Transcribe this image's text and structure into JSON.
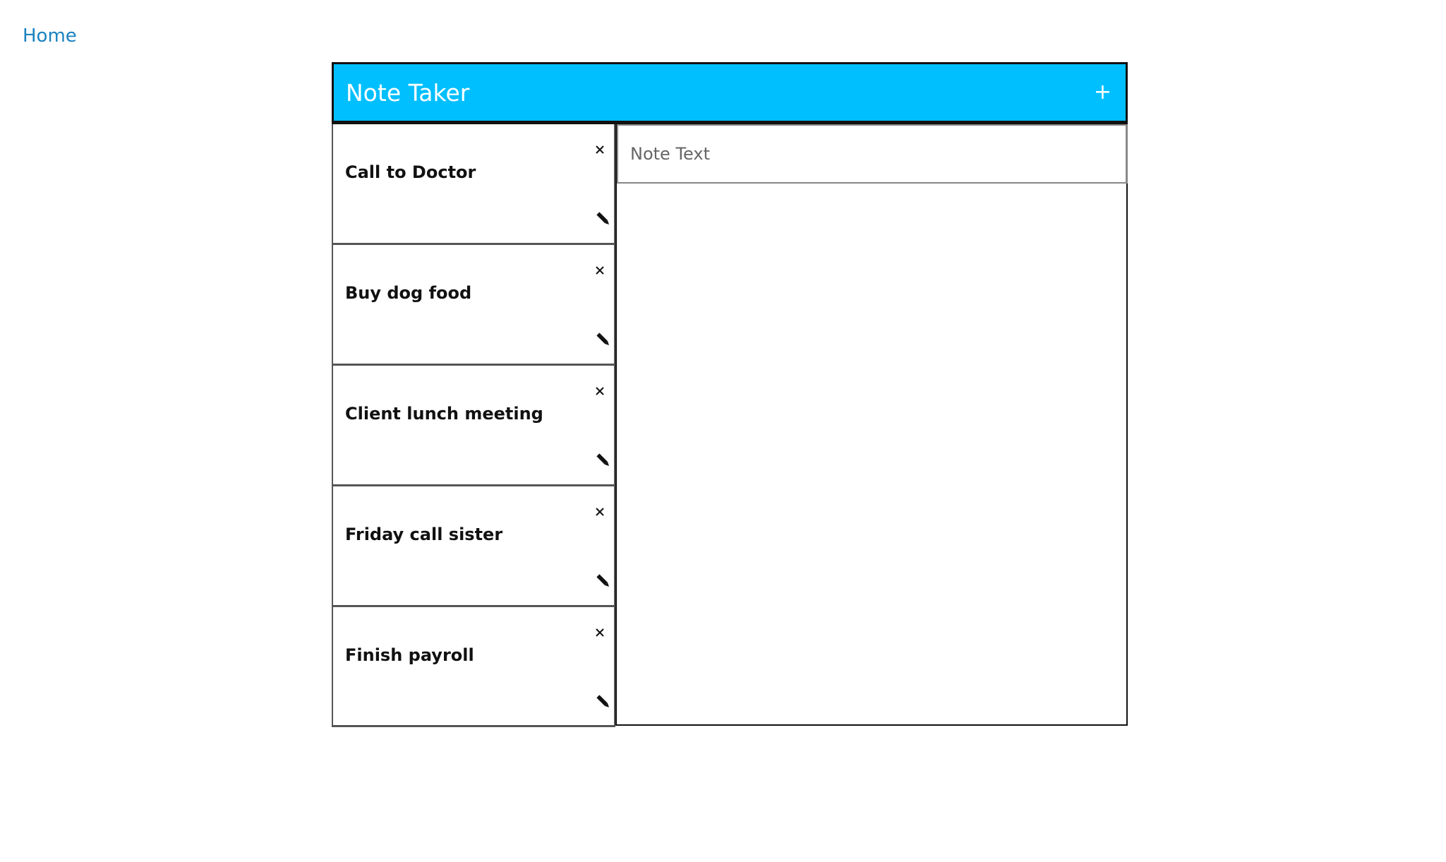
{
  "nav": {
    "home_label": "Home"
  },
  "header": {
    "title": "Note Taker",
    "add_label": "+"
  },
  "notes": [
    {
      "title": "Call to Doctor"
    },
    {
      "title": "Buy dog food"
    },
    {
      "title": "Client lunch meeting"
    },
    {
      "title": "Friday call sister"
    },
    {
      "title": "Finish payroll"
    }
  ],
  "editor": {
    "placeholder": "Note Text",
    "value": ""
  },
  "colors": {
    "header_bg": "#00bfff",
    "link": "#1a82c0"
  },
  "icons": {
    "delete": "close-icon",
    "edit": "pencil-icon"
  }
}
